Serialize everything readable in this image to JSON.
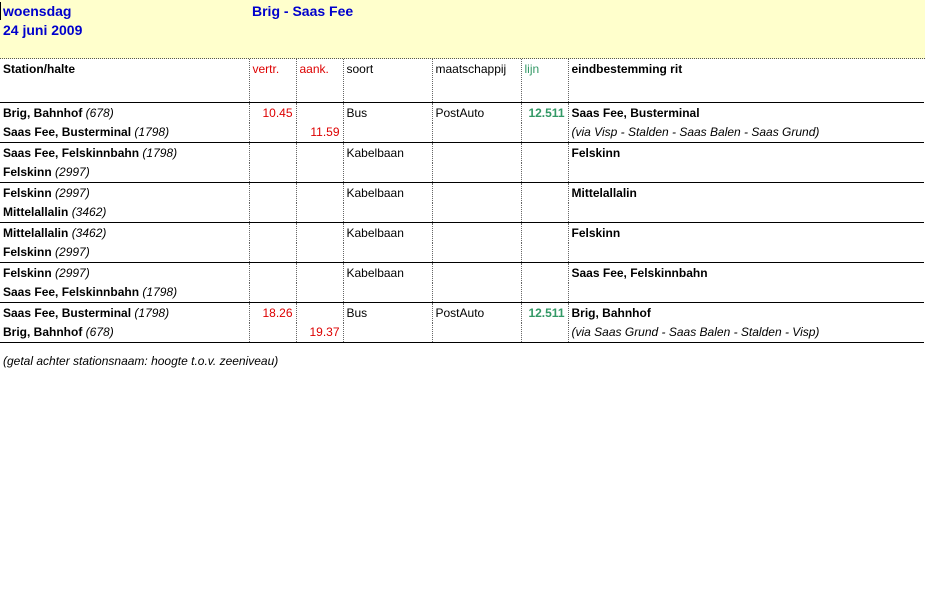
{
  "header": {
    "day": "woensdag",
    "date": "24 juni 2009",
    "route": "Brig - Saas Fee"
  },
  "columns": {
    "station": "Station/halte",
    "vertr": "vertr.",
    "aank": "aank.",
    "soort": "soort",
    "maatschappij": "maatschappij",
    "lijn": "lijn",
    "eindbestemming": "eindbestemming rit"
  },
  "legs": [
    {
      "from_name": "Brig, Bahnhof",
      "from_alt": "(678)",
      "to_name": "Saas Fee, Busterminal",
      "to_alt": "(1798)",
      "vertr": "10.45",
      "aank": "11.59",
      "soort": "Bus",
      "maatschappij": "PostAuto",
      "lijn": "12.511",
      "bestemming": "Saas Fee, Busterminal",
      "via": "(via Visp - Stalden - Saas Balen - Saas Grund)"
    },
    {
      "from_name": "Saas Fee, Felskinnbahn",
      "from_alt": "(1798)",
      "to_name": "Felskinn",
      "to_alt": "(2997)",
      "vertr": "",
      "aank": "",
      "soort": "Kabelbaan",
      "maatschappij": "",
      "lijn": "",
      "bestemming": "Felskinn",
      "via": ""
    },
    {
      "from_name": "Felskinn",
      "from_alt": "(2997)",
      "to_name": "Mittelallalin",
      "to_alt": "(3462)",
      "vertr": "",
      "aank": "",
      "soort": "Kabelbaan",
      "maatschappij": "",
      "lijn": "",
      "bestemming": "Mittelallalin",
      "via": ""
    },
    {
      "from_name": "Mittelallalin",
      "from_alt": "(3462)",
      "to_name": "Felskinn",
      "to_alt": "(2997)",
      "vertr": "",
      "aank": "",
      "soort": "Kabelbaan",
      "maatschappij": "",
      "lijn": "",
      "bestemming": "Felskinn",
      "via": ""
    },
    {
      "from_name": "Felskinn",
      "from_alt": "(2997)",
      "to_name": "Saas Fee, Felskinnbahn",
      "to_alt": "(1798)",
      "vertr": "",
      "aank": "",
      "soort": "Kabelbaan",
      "maatschappij": "",
      "lijn": "",
      "bestemming": "Saas Fee, Felskinnbahn",
      "via": ""
    },
    {
      "from_name": "Saas Fee, Busterminal",
      "from_alt": "(1798)",
      "to_name": "Brig, Bahnhof",
      "to_alt": "(678)",
      "vertr": "18.26",
      "aank": "19.37",
      "soort": "Bus",
      "maatschappij": "PostAuto",
      "lijn": "12.511",
      "bestemming": "Brig, Bahnhof",
      "via": "(via Saas Grund - Saas Balen - Stalden - Visp)"
    }
  ],
  "footnote": "(getal achter stationsnaam: hoogte t.o.v. zeeniveau)"
}
